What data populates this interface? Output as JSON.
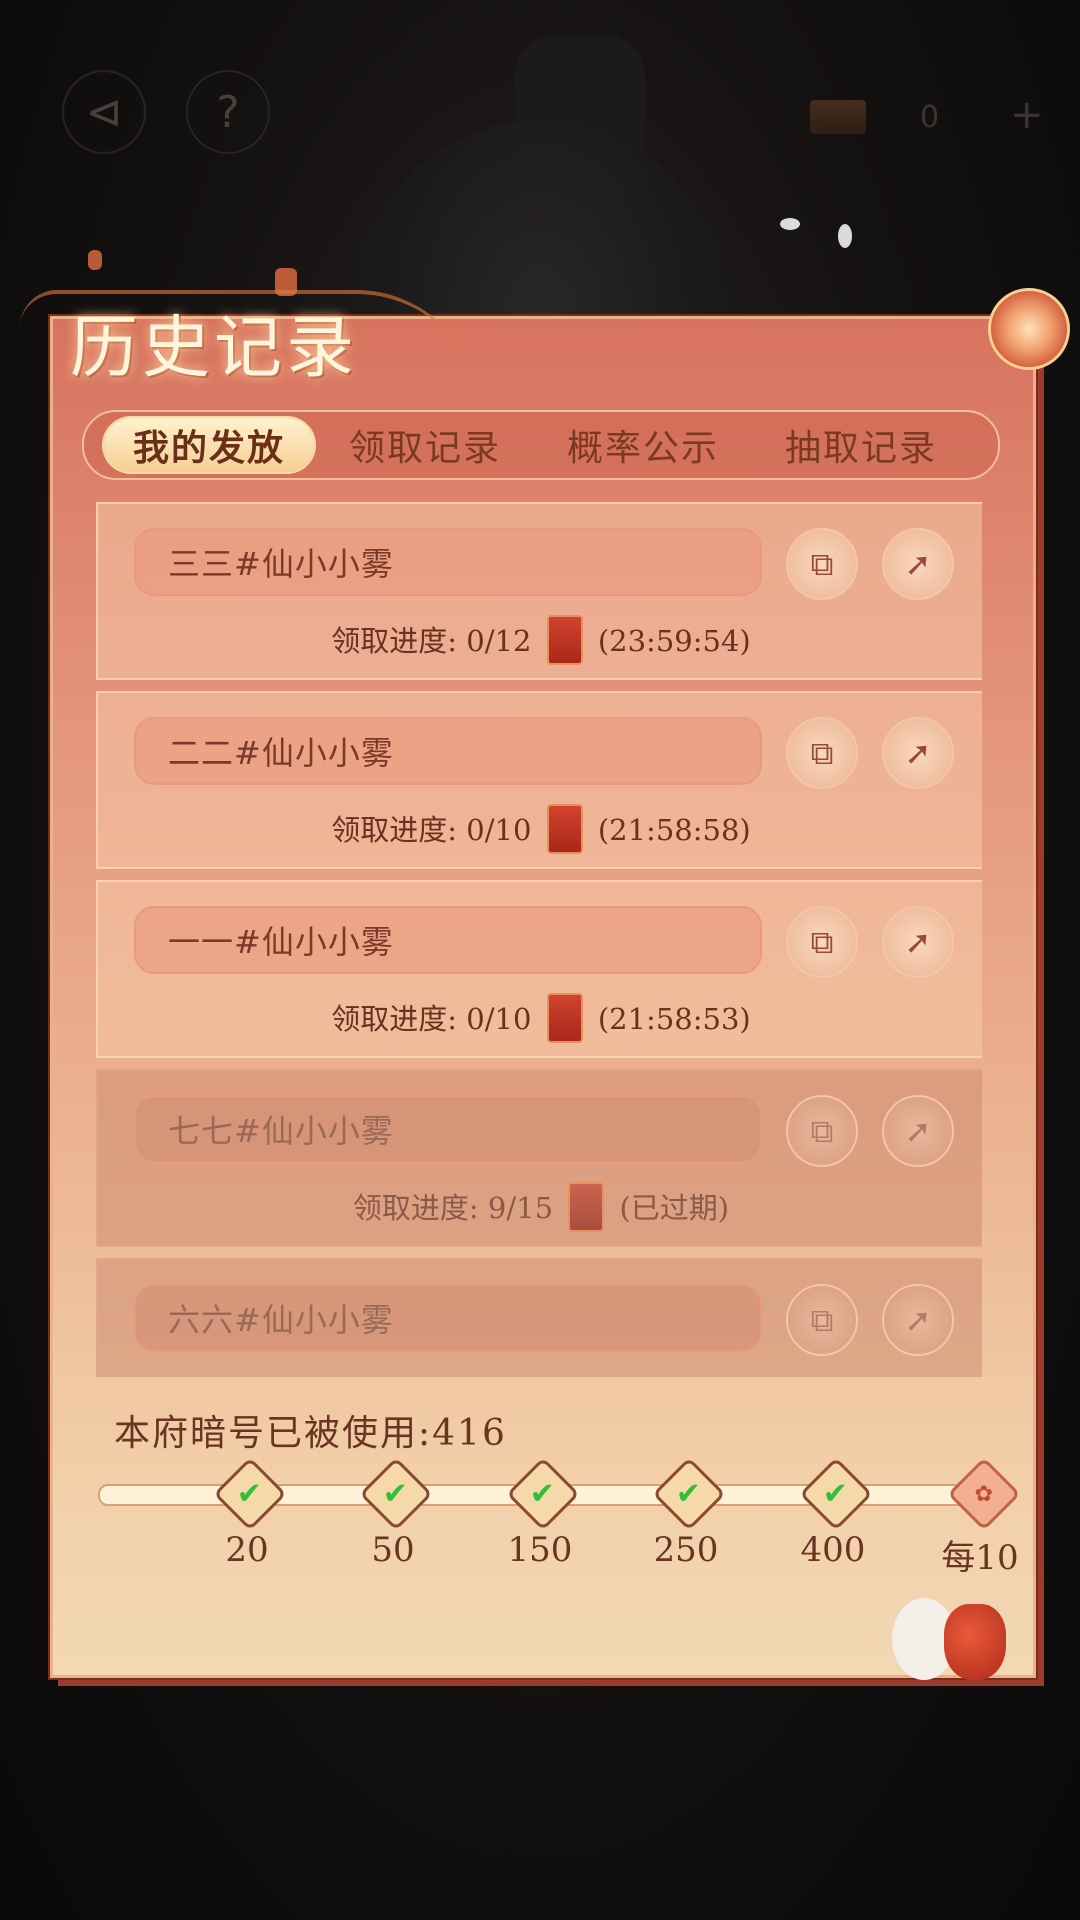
{
  "title": "历史记录",
  "topbar": {
    "back_glyph": "⊲",
    "help_glyph": "?",
    "currency_value": "0",
    "plus_glyph": "+"
  },
  "tabs": [
    {
      "label": "我的发放",
      "active": true
    },
    {
      "label": "领取记录",
      "active": false
    },
    {
      "label": "概率公示",
      "active": false
    },
    {
      "label": "抽取记录",
      "active": false
    }
  ],
  "records": [
    {
      "name": "三三#仙小小雾",
      "progress_label": "领取进度:",
      "progress": "0/12",
      "status": "(23:59:54)",
      "expired": false
    },
    {
      "name": "二二#仙小小雾",
      "progress_label": "领取进度:",
      "progress": "0/10",
      "status": "(21:58:58)",
      "expired": false
    },
    {
      "name": "一一#仙小小雾",
      "progress_label": "领取进度:",
      "progress": "0/10",
      "status": "(21:58:53)",
      "expired": false
    },
    {
      "name": "七七#仙小小雾",
      "progress_label": "领取进度:",
      "progress": "9/15",
      "status": "(已过期)",
      "expired": true
    },
    {
      "name": "六六#仙小小雾",
      "progress_label": "",
      "progress": "",
      "status": "",
      "expired": true
    }
  ],
  "icons": {
    "copy": "copy-icon",
    "share": "share-icon"
  },
  "usage": {
    "label": "本府暗号已被使用:",
    "count": "416"
  },
  "milestones": [
    {
      "label": "20",
      "reached": true
    },
    {
      "label": "50",
      "reached": true
    },
    {
      "label": "150",
      "reached": true
    },
    {
      "label": "250",
      "reached": true
    },
    {
      "label": "400",
      "reached": true
    },
    {
      "label": "每10",
      "reached": false
    }
  ],
  "colors": {
    "panel_top": "#d7735e",
    "panel_bottom": "#f3d8b4",
    "check_green": "#2fbf3a"
  }
}
